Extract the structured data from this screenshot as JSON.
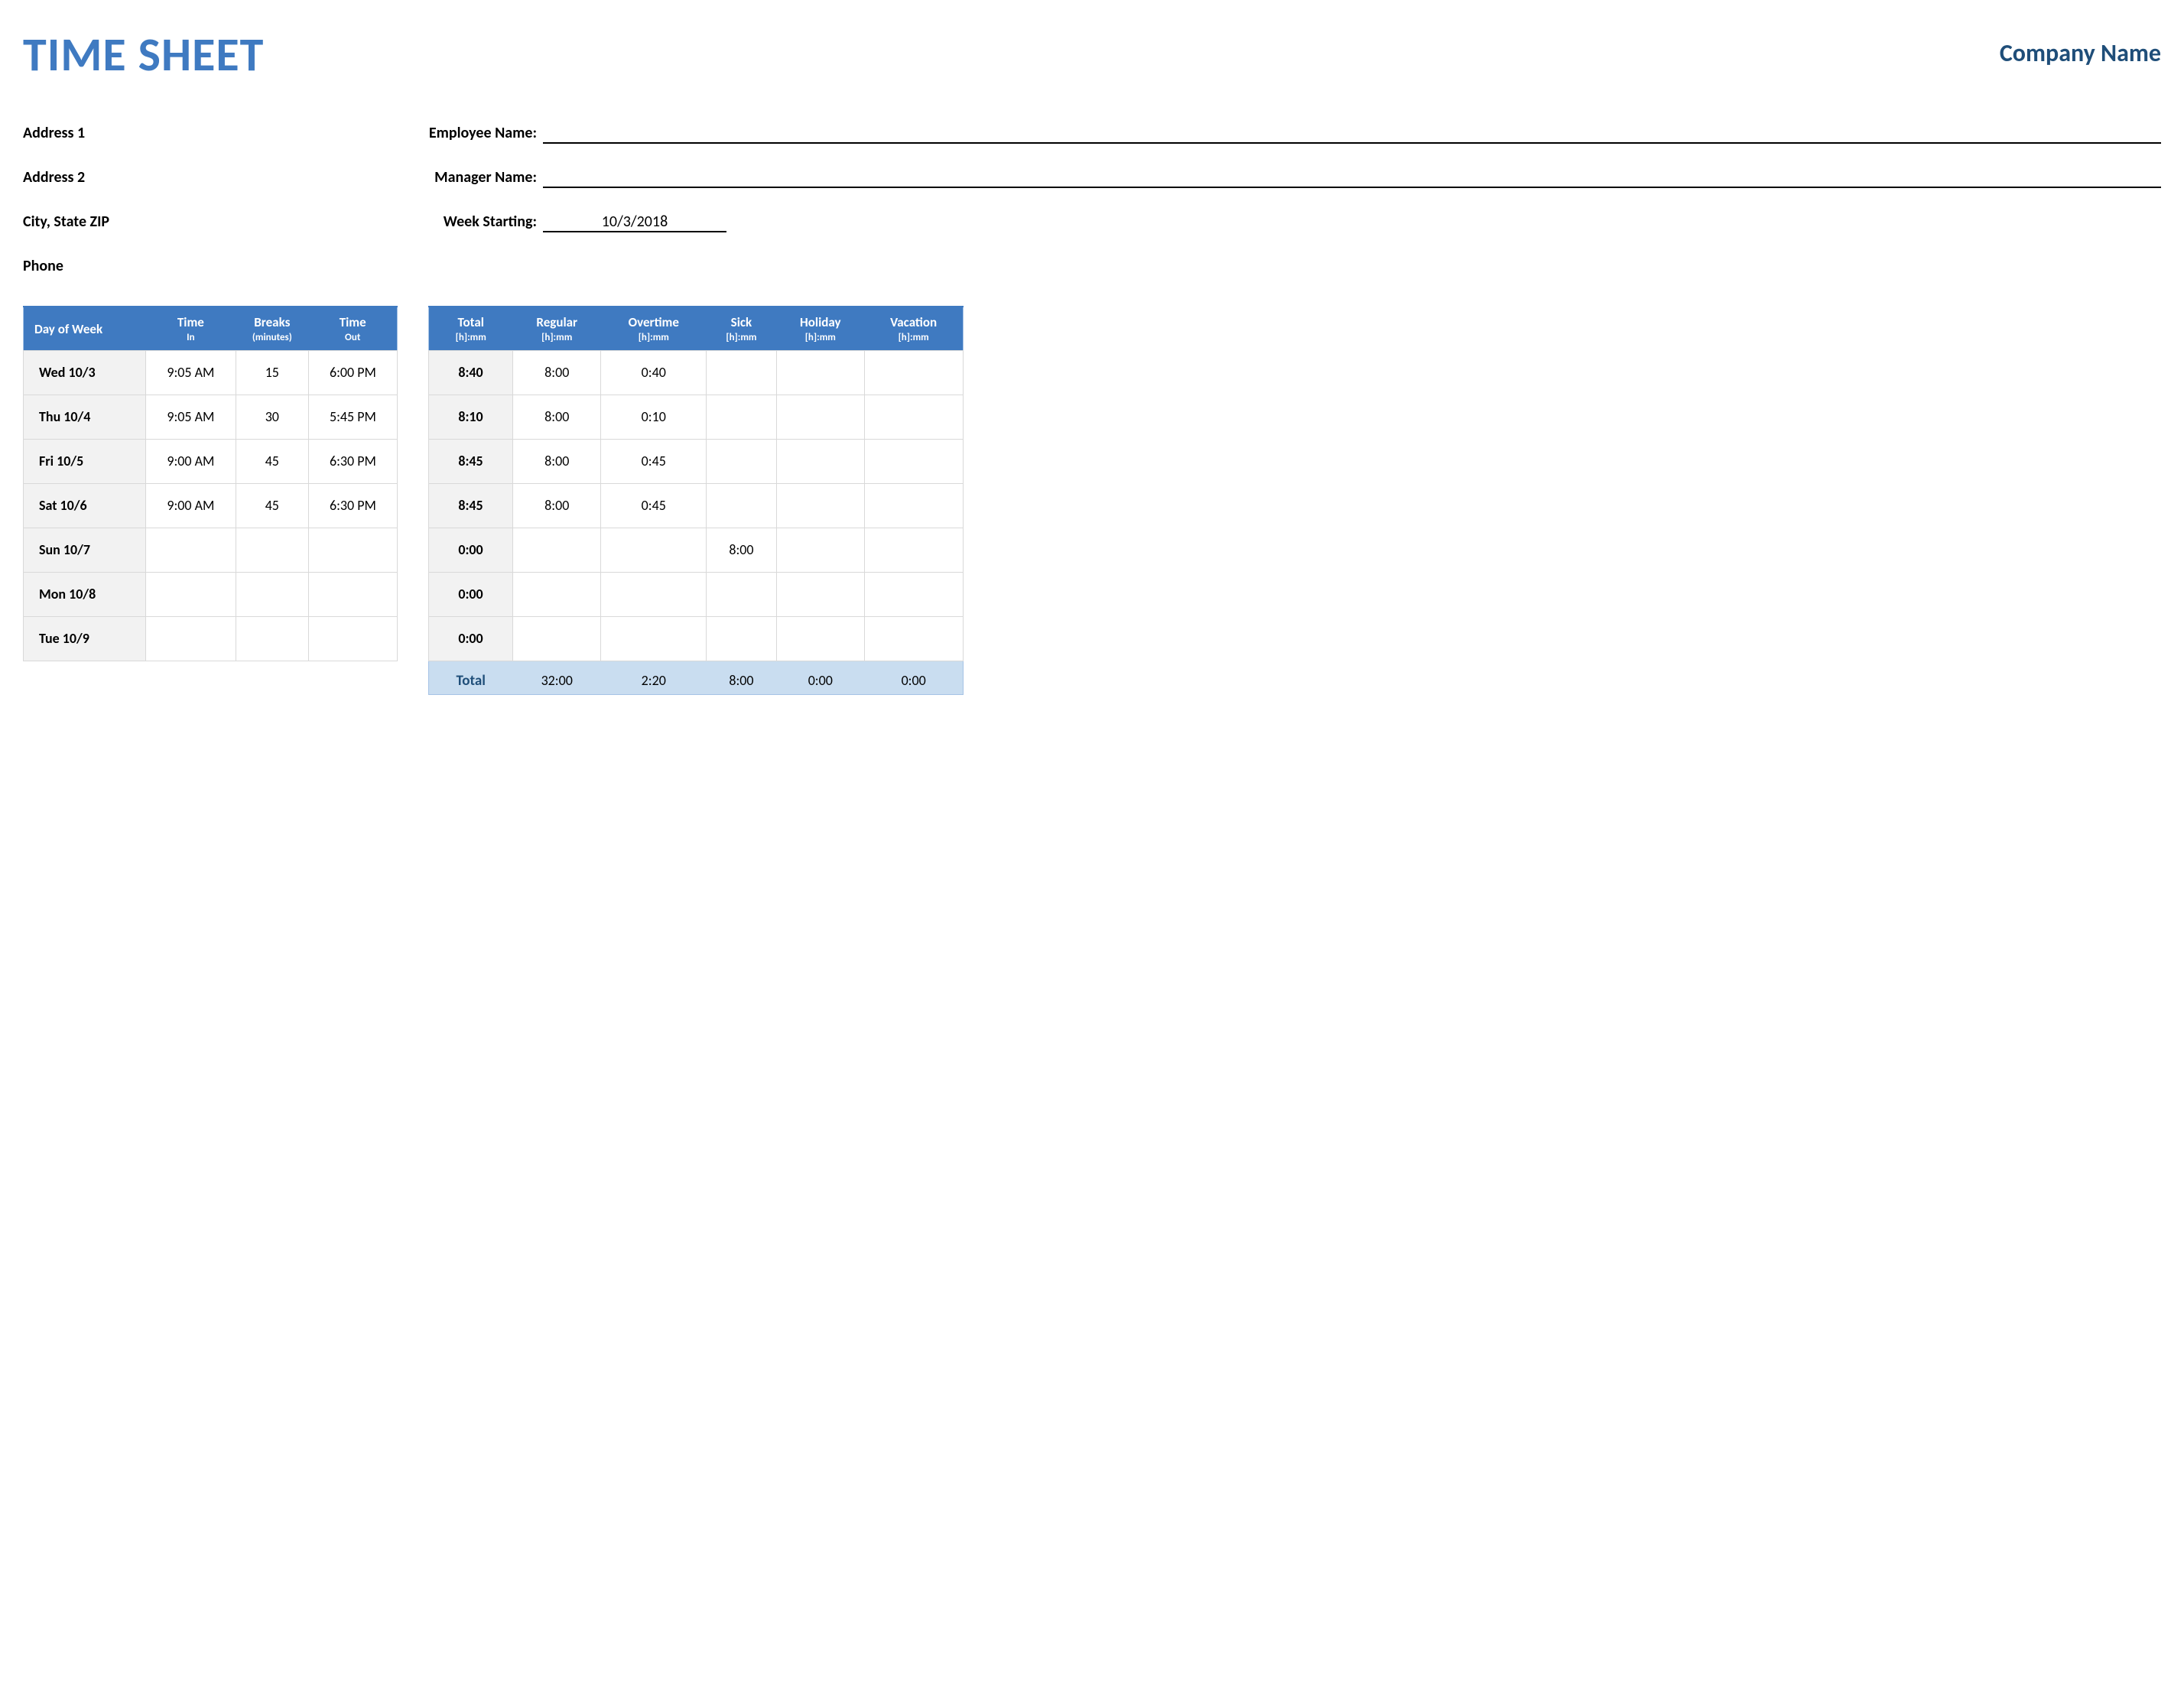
{
  "header": {
    "title": "TIME SHEET",
    "company": "Company Name"
  },
  "info": {
    "address1": "Address 1",
    "address2": "Address 2",
    "city_state_zip": "City, State  ZIP",
    "phone": "Phone",
    "employee_label": "Employee Name:",
    "manager_label": "Manager Name:",
    "week_starting_label": "Week Starting:",
    "employee_value": "",
    "manager_value": "",
    "week_starting_value": "10/3/2018"
  },
  "left_headers": {
    "day": "Day of Week",
    "time_in": "Time",
    "time_in_sub": "In",
    "breaks": "Breaks",
    "breaks_sub": "(minutes)",
    "time_out": "Time",
    "time_out_sub": "Out"
  },
  "right_headers": {
    "total": "Total",
    "regular": "Regular",
    "overtime": "Overtime",
    "sick": "Sick",
    "holiday": "Holiday",
    "vacation": "Vacation",
    "sub": "[h]:mm"
  },
  "rows": [
    {
      "day": "Wed 10/3",
      "in": "9:05 AM",
      "breaks": "15",
      "out": "6:00 PM",
      "total": "8:40",
      "regular": "8:00",
      "overtime": "0:40",
      "sick": "",
      "holiday": "",
      "vacation": ""
    },
    {
      "day": "Thu 10/4",
      "in": "9:05 AM",
      "breaks": "30",
      "out": "5:45 PM",
      "total": "8:10",
      "regular": "8:00",
      "overtime": "0:10",
      "sick": "",
      "holiday": "",
      "vacation": ""
    },
    {
      "day": "Fri 10/5",
      "in": "9:00 AM",
      "breaks": "45",
      "out": "6:30 PM",
      "total": "8:45",
      "regular": "8:00",
      "overtime": "0:45",
      "sick": "",
      "holiday": "",
      "vacation": ""
    },
    {
      "day": "Sat 10/6",
      "in": "9:00 AM",
      "breaks": "45",
      "out": "6:30 PM",
      "total": "8:45",
      "regular": "8:00",
      "overtime": "0:45",
      "sick": "",
      "holiday": "",
      "vacation": ""
    },
    {
      "day": "Sun 10/7",
      "in": "",
      "breaks": "",
      "out": "",
      "total": "0:00",
      "regular": "",
      "overtime": "",
      "sick": "8:00",
      "holiday": "",
      "vacation": ""
    },
    {
      "day": "Mon 10/8",
      "in": "",
      "breaks": "",
      "out": "",
      "total": "0:00",
      "regular": "",
      "overtime": "",
      "sick": "",
      "holiday": "",
      "vacation": ""
    },
    {
      "day": "Tue 10/9",
      "in": "",
      "breaks": "",
      "out": "",
      "total": "0:00",
      "regular": "",
      "overtime": "",
      "sick": "",
      "holiday": "",
      "vacation": ""
    }
  ],
  "totals": {
    "label": "Total",
    "regular": "32:00",
    "overtime": "2:20",
    "sick": "8:00",
    "holiday": "0:00",
    "vacation": "0:00"
  }
}
